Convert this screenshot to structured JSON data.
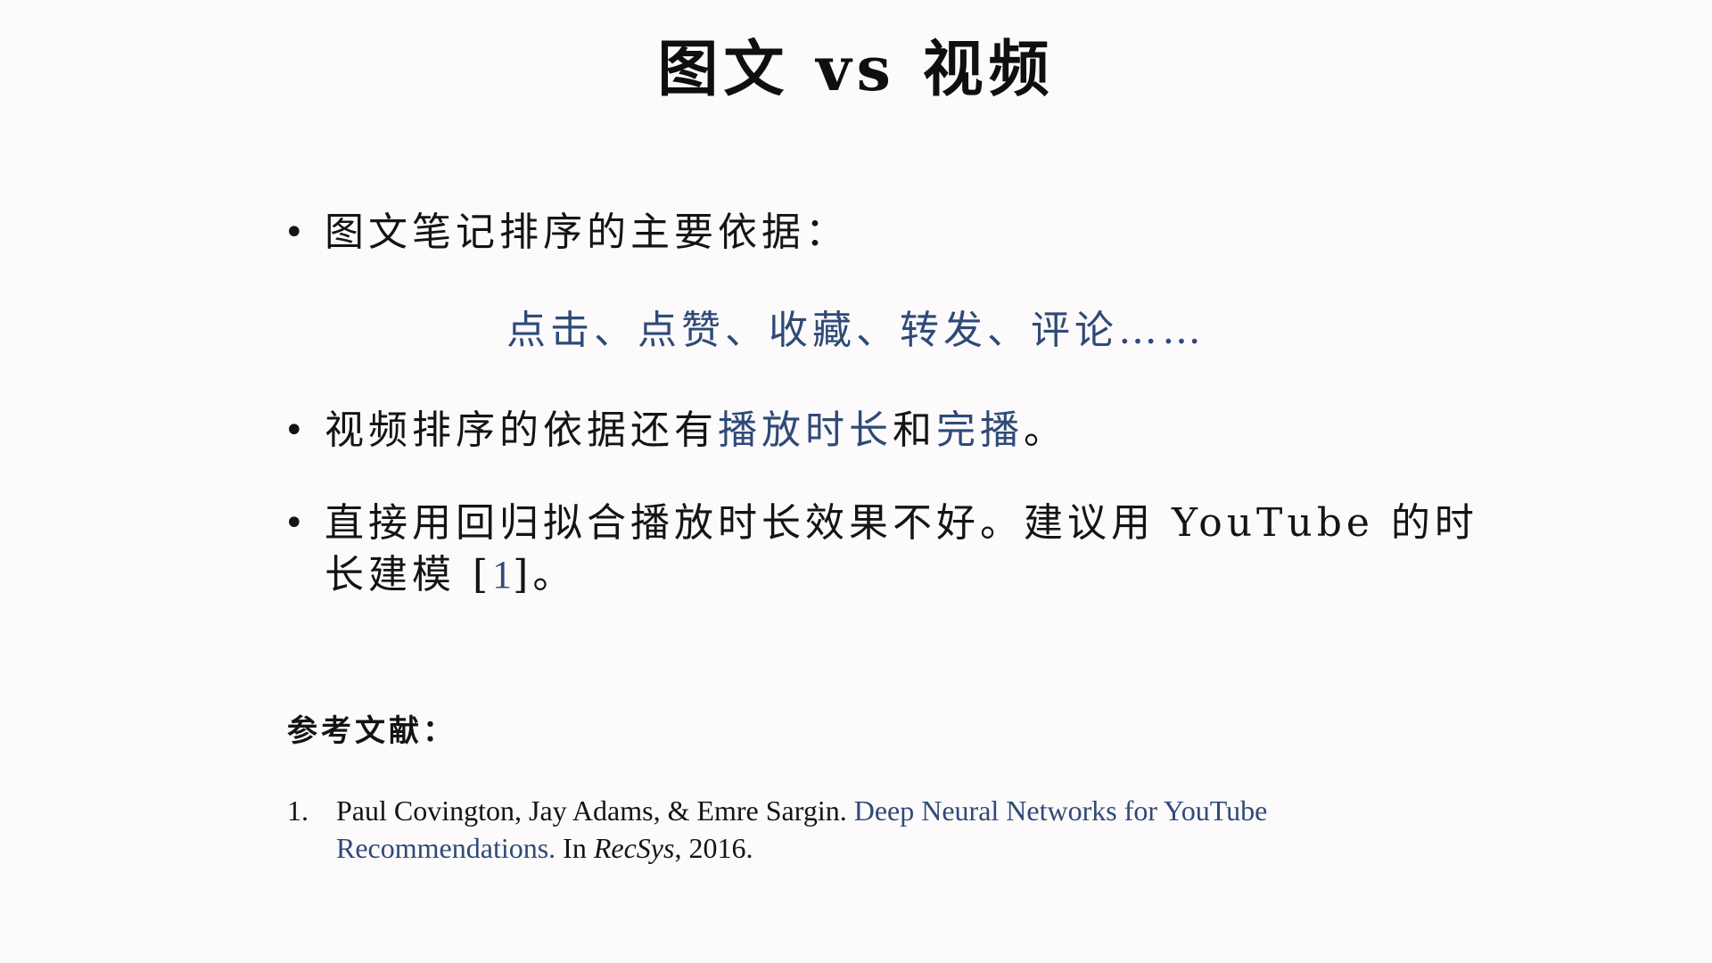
{
  "title": "图文 vs 视频",
  "bullets": {
    "b1": "图文笔记排序的主要依据：",
    "b1_sub": "点击、点赞、收藏、转发、评论……",
    "b2_prefix": "视频排序的依据还有",
    "b2_accent1": "播放时长",
    "b2_mid": "和",
    "b2_accent2": "完播",
    "b2_suffix": "。",
    "b3_prefix": "直接用回归拟合播放时长效果不好。建议用 YouTube 的时长建模 [",
    "b3_ref": "1",
    "b3_suffix": "]。"
  },
  "references": {
    "heading": "参考文献：",
    "items": [
      {
        "num": "1.",
        "authors": "Paul Covington, Jay Adams, & Emre Sargin. ",
        "title": "Deep Neural Networks for YouTube Recommendations.",
        "in": " In ",
        "venue": "RecSys",
        "year": ", 2016."
      }
    ]
  },
  "colors": {
    "accent": "#2f4a78",
    "text": "#141414",
    "background": "#fcfafb"
  }
}
